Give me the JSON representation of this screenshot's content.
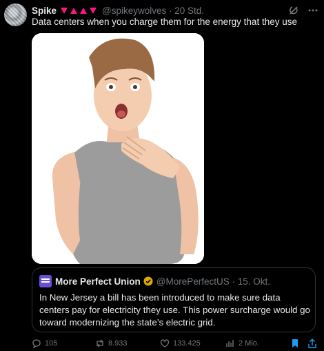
{
  "tweet": {
    "author_name": "Spike",
    "handle_time": "@spikeywolves · 20 Std.",
    "text": "Data centers when you charge them for the energy that they use",
    "image_alt": "surprised-woman-photo"
  },
  "quoted": {
    "name": "More Perfect Union",
    "handle_date": "@MorePerfectUS · 15. Okt.",
    "text": "In New Jersey a bill has been introduced to make sure data centers pay for electricity they use. This power surcharge would go toward modernizing the state’s electric grid."
  },
  "actions": {
    "replies": "105",
    "reposts": "8.933",
    "likes": "133.425",
    "views": "2 Mio."
  },
  "colors": {
    "accent": "#1d9bf0",
    "pink": "#f91880",
    "muted": "#71767b"
  },
  "icons": [
    "grok-icon",
    "more-icon",
    "reply-icon",
    "repost-icon",
    "like-icon",
    "views-icon",
    "bookmark-icon"
  ]
}
